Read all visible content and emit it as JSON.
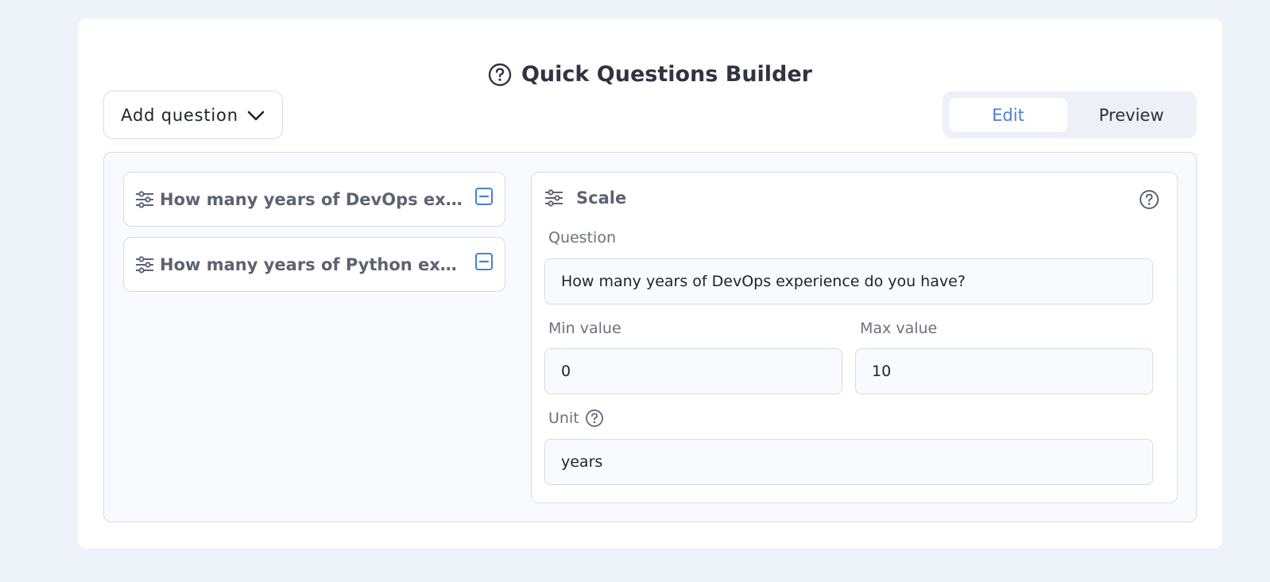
{
  "header": {
    "title": "Quick Questions Builder",
    "title_icon": "question-circle-icon"
  },
  "toolbar": {
    "add_label": "Add question",
    "add_icon": "chevron-down-icon"
  },
  "mode_toggle": {
    "options": [
      "Edit",
      "Preview"
    ],
    "selected": "Edit"
  },
  "question_list": {
    "items": [
      {
        "text": "How many years of DevOps experience do you have?",
        "display_text": "How many years of DevOps expe...",
        "icon": "sliders-icon",
        "action_icon": "minus-square-icon"
      },
      {
        "text": "How many years of Python experience do you have?",
        "display_text": "How many years of Python expe...",
        "icon": "sliders-icon",
        "action_icon": "minus-square-icon"
      }
    ]
  },
  "editor": {
    "type_label": "Scale",
    "type_icon": "sliders-icon",
    "help_icon": "question-circle-icon",
    "question_label": "Question",
    "question_value": "How many years of DevOps experience do you have?",
    "min_label": "Min value",
    "min_value": "0",
    "max_label": "Max value",
    "max_value": "10",
    "unit_label": "Unit",
    "unit_value": "years"
  },
  "colors": {
    "page_bg": "#eef2f9",
    "accent": "#4a7fd6",
    "border": "#d6dce6",
    "muted_text": "#5d6370"
  }
}
